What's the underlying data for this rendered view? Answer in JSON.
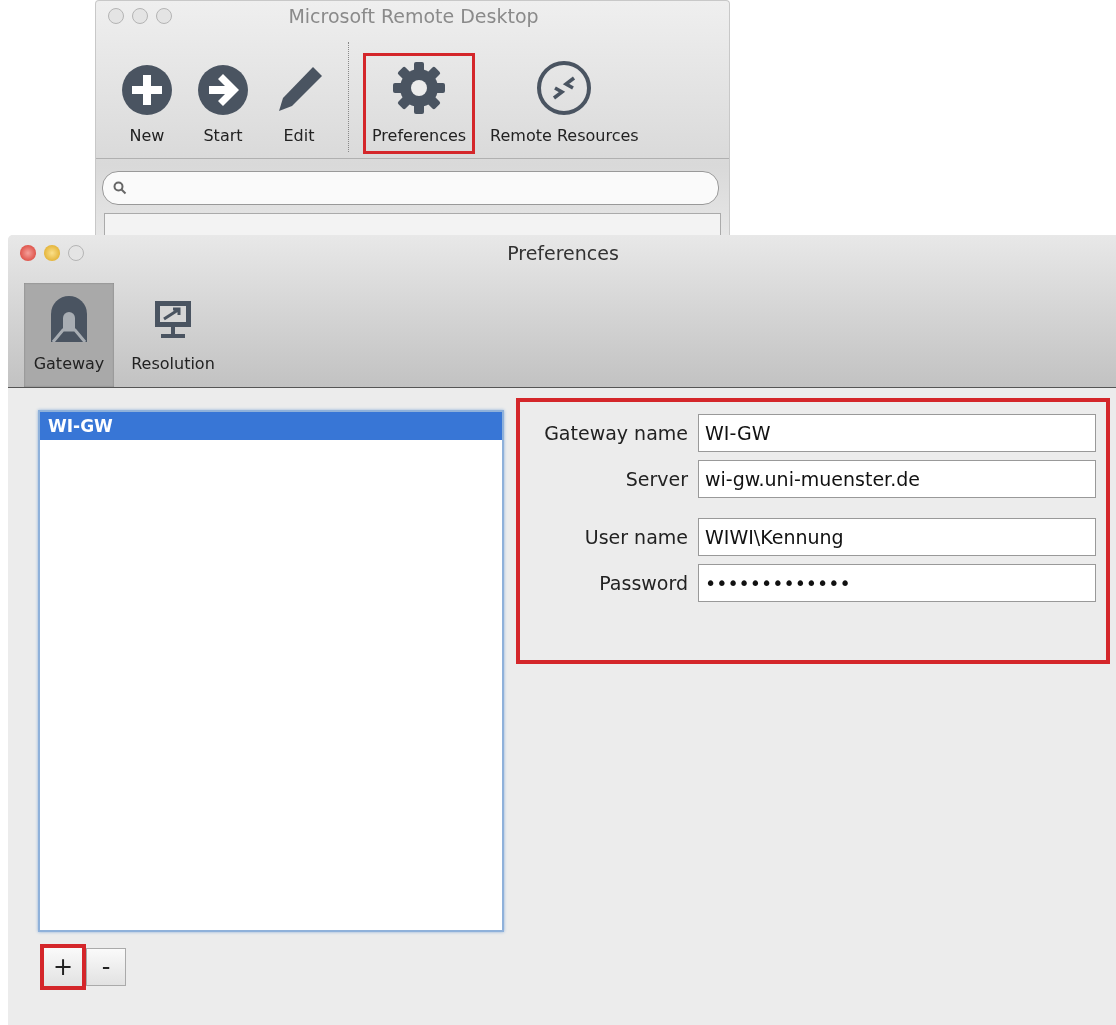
{
  "main_window": {
    "title": "Microsoft Remote Desktop",
    "toolbar": [
      {
        "label": "New",
        "kind": "plus",
        "highlighted": false
      },
      {
        "label": "Start",
        "kind": "arrow",
        "highlighted": false
      },
      {
        "label": "Edit",
        "kind": "pencil",
        "highlighted": false
      },
      {
        "label": "Preferences",
        "kind": "gear",
        "highlighted": true
      },
      {
        "label": "Remote Resources",
        "kind": "remote",
        "highlighted": false
      }
    ]
  },
  "preferences_window": {
    "title": "Preferences",
    "tabs": [
      {
        "label": "Gateway",
        "kind": "gateway",
        "selected": true
      },
      {
        "label": "Resolution",
        "kind": "display",
        "selected": false
      }
    ],
    "gateways": [
      {
        "name": "WI-GW",
        "selected": true
      }
    ],
    "form_highlighted": true,
    "fields": [
      {
        "label": "Gateway name",
        "value": "WI-GW"
      },
      {
        "label": "Server",
        "value": "wi-gw.uni-muenster.de"
      },
      {
        "label": "User name",
        "value": "WIWI\\Kennung"
      },
      {
        "label": "Password",
        "value": "•••••••••••••"
      }
    ],
    "buttons": [
      {
        "label": "+",
        "highlighted": true
      },
      {
        "label": "-",
        "highlighted": false
      }
    ]
  }
}
